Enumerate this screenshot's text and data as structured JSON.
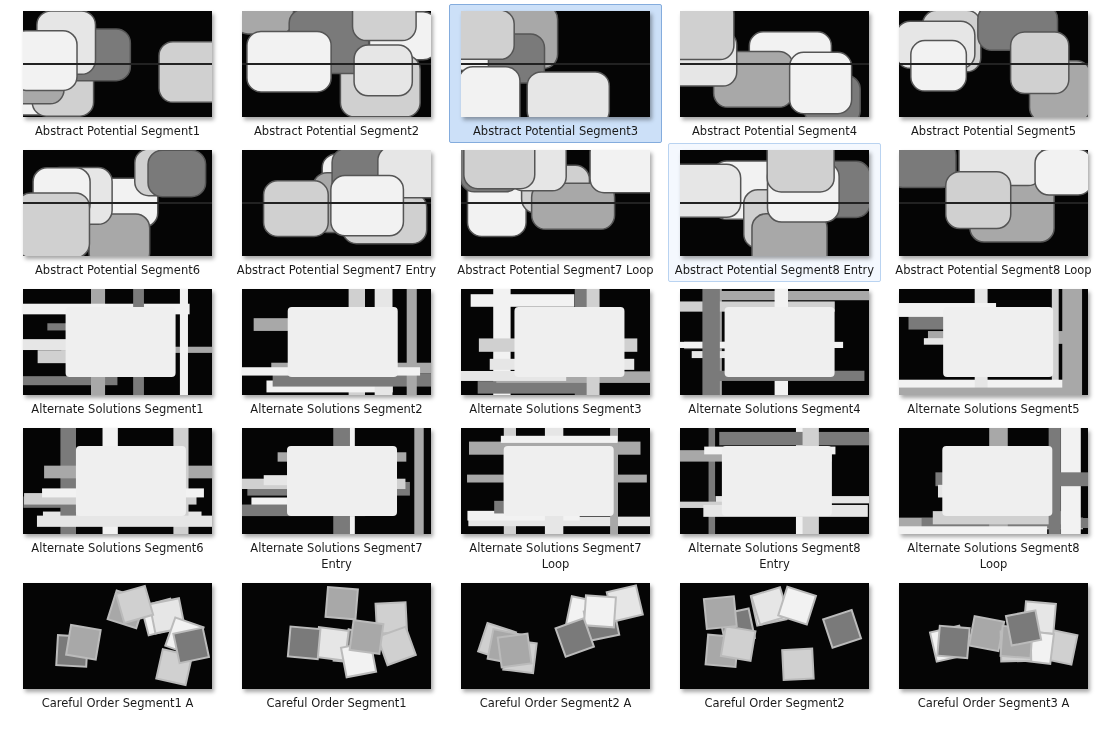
{
  "items": [
    {
      "name": "Abstract Potential Segment1",
      "selected": false,
      "hover": false
    },
    {
      "name": "Abstract Potential Segment2",
      "selected": false,
      "hover": false
    },
    {
      "name": "Abstract Potential Segment3",
      "selected": true,
      "hover": false
    },
    {
      "name": "Abstract Potential Segment4",
      "selected": false,
      "hover": false
    },
    {
      "name": "Abstract Potential Segment5",
      "selected": false,
      "hover": false
    },
    {
      "name": "Abstract Potential Segment6",
      "selected": false,
      "hover": false
    },
    {
      "name": "Abstract Potential Segment7 Entry",
      "selected": false,
      "hover": false
    },
    {
      "name": "Abstract Potential Segment7 Loop",
      "selected": false,
      "hover": false
    },
    {
      "name": "Abstract Potential Segment8 Entry",
      "selected": false,
      "hover": true
    },
    {
      "name": "Abstract Potential Segment8 Loop",
      "selected": false,
      "hover": false
    },
    {
      "name": "Alternate Solutions Segment1",
      "selected": false,
      "hover": false
    },
    {
      "name": "Alternate Solutions Segment2",
      "selected": false,
      "hover": false
    },
    {
      "name": "Alternate Solutions Segment3",
      "selected": false,
      "hover": false
    },
    {
      "name": "Alternate Solutions Segment4",
      "selected": false,
      "hover": false
    },
    {
      "name": "Alternate Solutions Segment5",
      "selected": false,
      "hover": false
    },
    {
      "name": "Alternate Solutions Segment6",
      "selected": false,
      "hover": false
    },
    {
      "name": "Alternate Solutions Segment7 Entry",
      "selected": false,
      "hover": false
    },
    {
      "name": "Alternate Solutions Segment7 Loop",
      "selected": false,
      "hover": false
    },
    {
      "name": "Alternate Solutions Segment8 Entry",
      "selected": false,
      "hover": false
    },
    {
      "name": "Alternate Solutions Segment8 Loop",
      "selected": false,
      "hover": false
    },
    {
      "name": "Careful Order Segment1 A",
      "selected": false,
      "hover": false
    },
    {
      "name": "Careful Order Segment1",
      "selected": false,
      "hover": false
    },
    {
      "name": "Careful Order Segment2 A",
      "selected": false,
      "hover": false
    },
    {
      "name": "Careful Order Segment2",
      "selected": false,
      "hover": false
    },
    {
      "name": "Careful Order Segment3 A",
      "selected": false,
      "hover": false
    }
  ]
}
